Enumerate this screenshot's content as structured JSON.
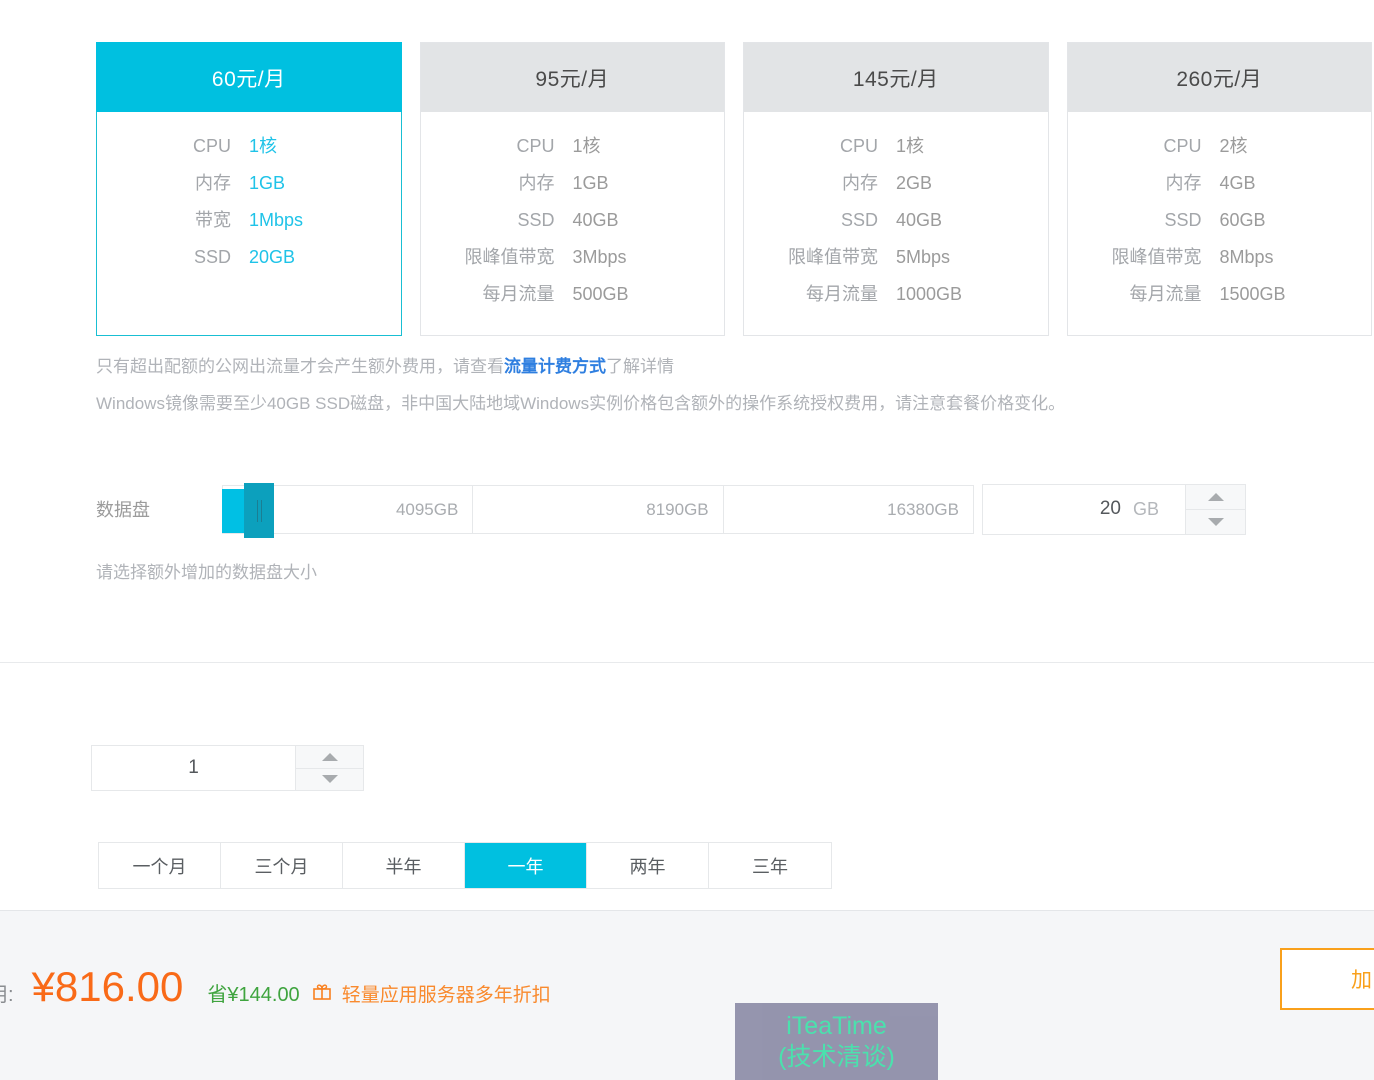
{
  "plans": [
    {
      "price": "60元/月",
      "selected": true,
      "specs": [
        {
          "label": "CPU",
          "value": "1核"
        },
        {
          "label": "内存",
          "value": "1GB"
        },
        {
          "label": "带宽",
          "value": "1Mbps"
        },
        {
          "label": "SSD",
          "value": "20GB"
        }
      ]
    },
    {
      "price": "95元/月",
      "selected": false,
      "specs": [
        {
          "label": "CPU",
          "value": "1核"
        },
        {
          "label": "内存",
          "value": "1GB"
        },
        {
          "label": "SSD",
          "value": "40GB"
        },
        {
          "label": "限峰值带宽",
          "value": "3Mbps"
        },
        {
          "label": "每月流量",
          "value": "500GB"
        }
      ]
    },
    {
      "price": "145元/月",
      "selected": false,
      "specs": [
        {
          "label": "CPU",
          "value": "1核"
        },
        {
          "label": "内存",
          "value": "2GB"
        },
        {
          "label": "SSD",
          "value": "40GB"
        },
        {
          "label": "限峰值带宽",
          "value": "5Mbps"
        },
        {
          "label": "每月流量",
          "value": "1000GB"
        }
      ]
    },
    {
      "price": "260元/月",
      "selected": false,
      "specs": [
        {
          "label": "CPU",
          "value": "2核"
        },
        {
          "label": "内存",
          "value": "4GB"
        },
        {
          "label": "SSD",
          "value": "60GB"
        },
        {
          "label": "限峰值带宽",
          "value": "8Mbps"
        },
        {
          "label": "每月流量",
          "value": "1500GB"
        }
      ]
    }
  ],
  "notes": {
    "line1_before": "只有超出配额的公网出流量才会产生额外费用，请查看",
    "line1_link": "流量计费方式",
    "line1_after": "了解详情",
    "line2": "Windows镜像需要至少40GB SSD磁盘，非中国大陆地域Windows实例价格包含额外的操作系统授权费用，请注意套餐价格变化。"
  },
  "data_disk": {
    "label": "数据盘",
    "ticks": [
      "4095GB",
      "8190GB",
      "16380GB"
    ],
    "value": "20",
    "unit": "GB",
    "hint": "请选择额外增加的数据盘大小"
  },
  "quantity": {
    "value": "1"
  },
  "durations": {
    "options": [
      "一个月",
      "三个月",
      "半年",
      "一年",
      "两年",
      "三年"
    ],
    "selected": "一年"
  },
  "bottom": {
    "fee_label": "用:",
    "price": "¥816.00",
    "save": "省¥144.00",
    "gift_icon": "gift-icon",
    "promo": "轻量应用服务器多年折扣",
    "cart_label": "加"
  },
  "watermark": {
    "line1": "iTeaTime",
    "line2": "(技术清谈)"
  },
  "colors": {
    "accent": "#00c0e0",
    "price": "#f96a18",
    "save": "#3fa43f",
    "promo": "#f98a2e",
    "link": "#2f7fe0"
  }
}
